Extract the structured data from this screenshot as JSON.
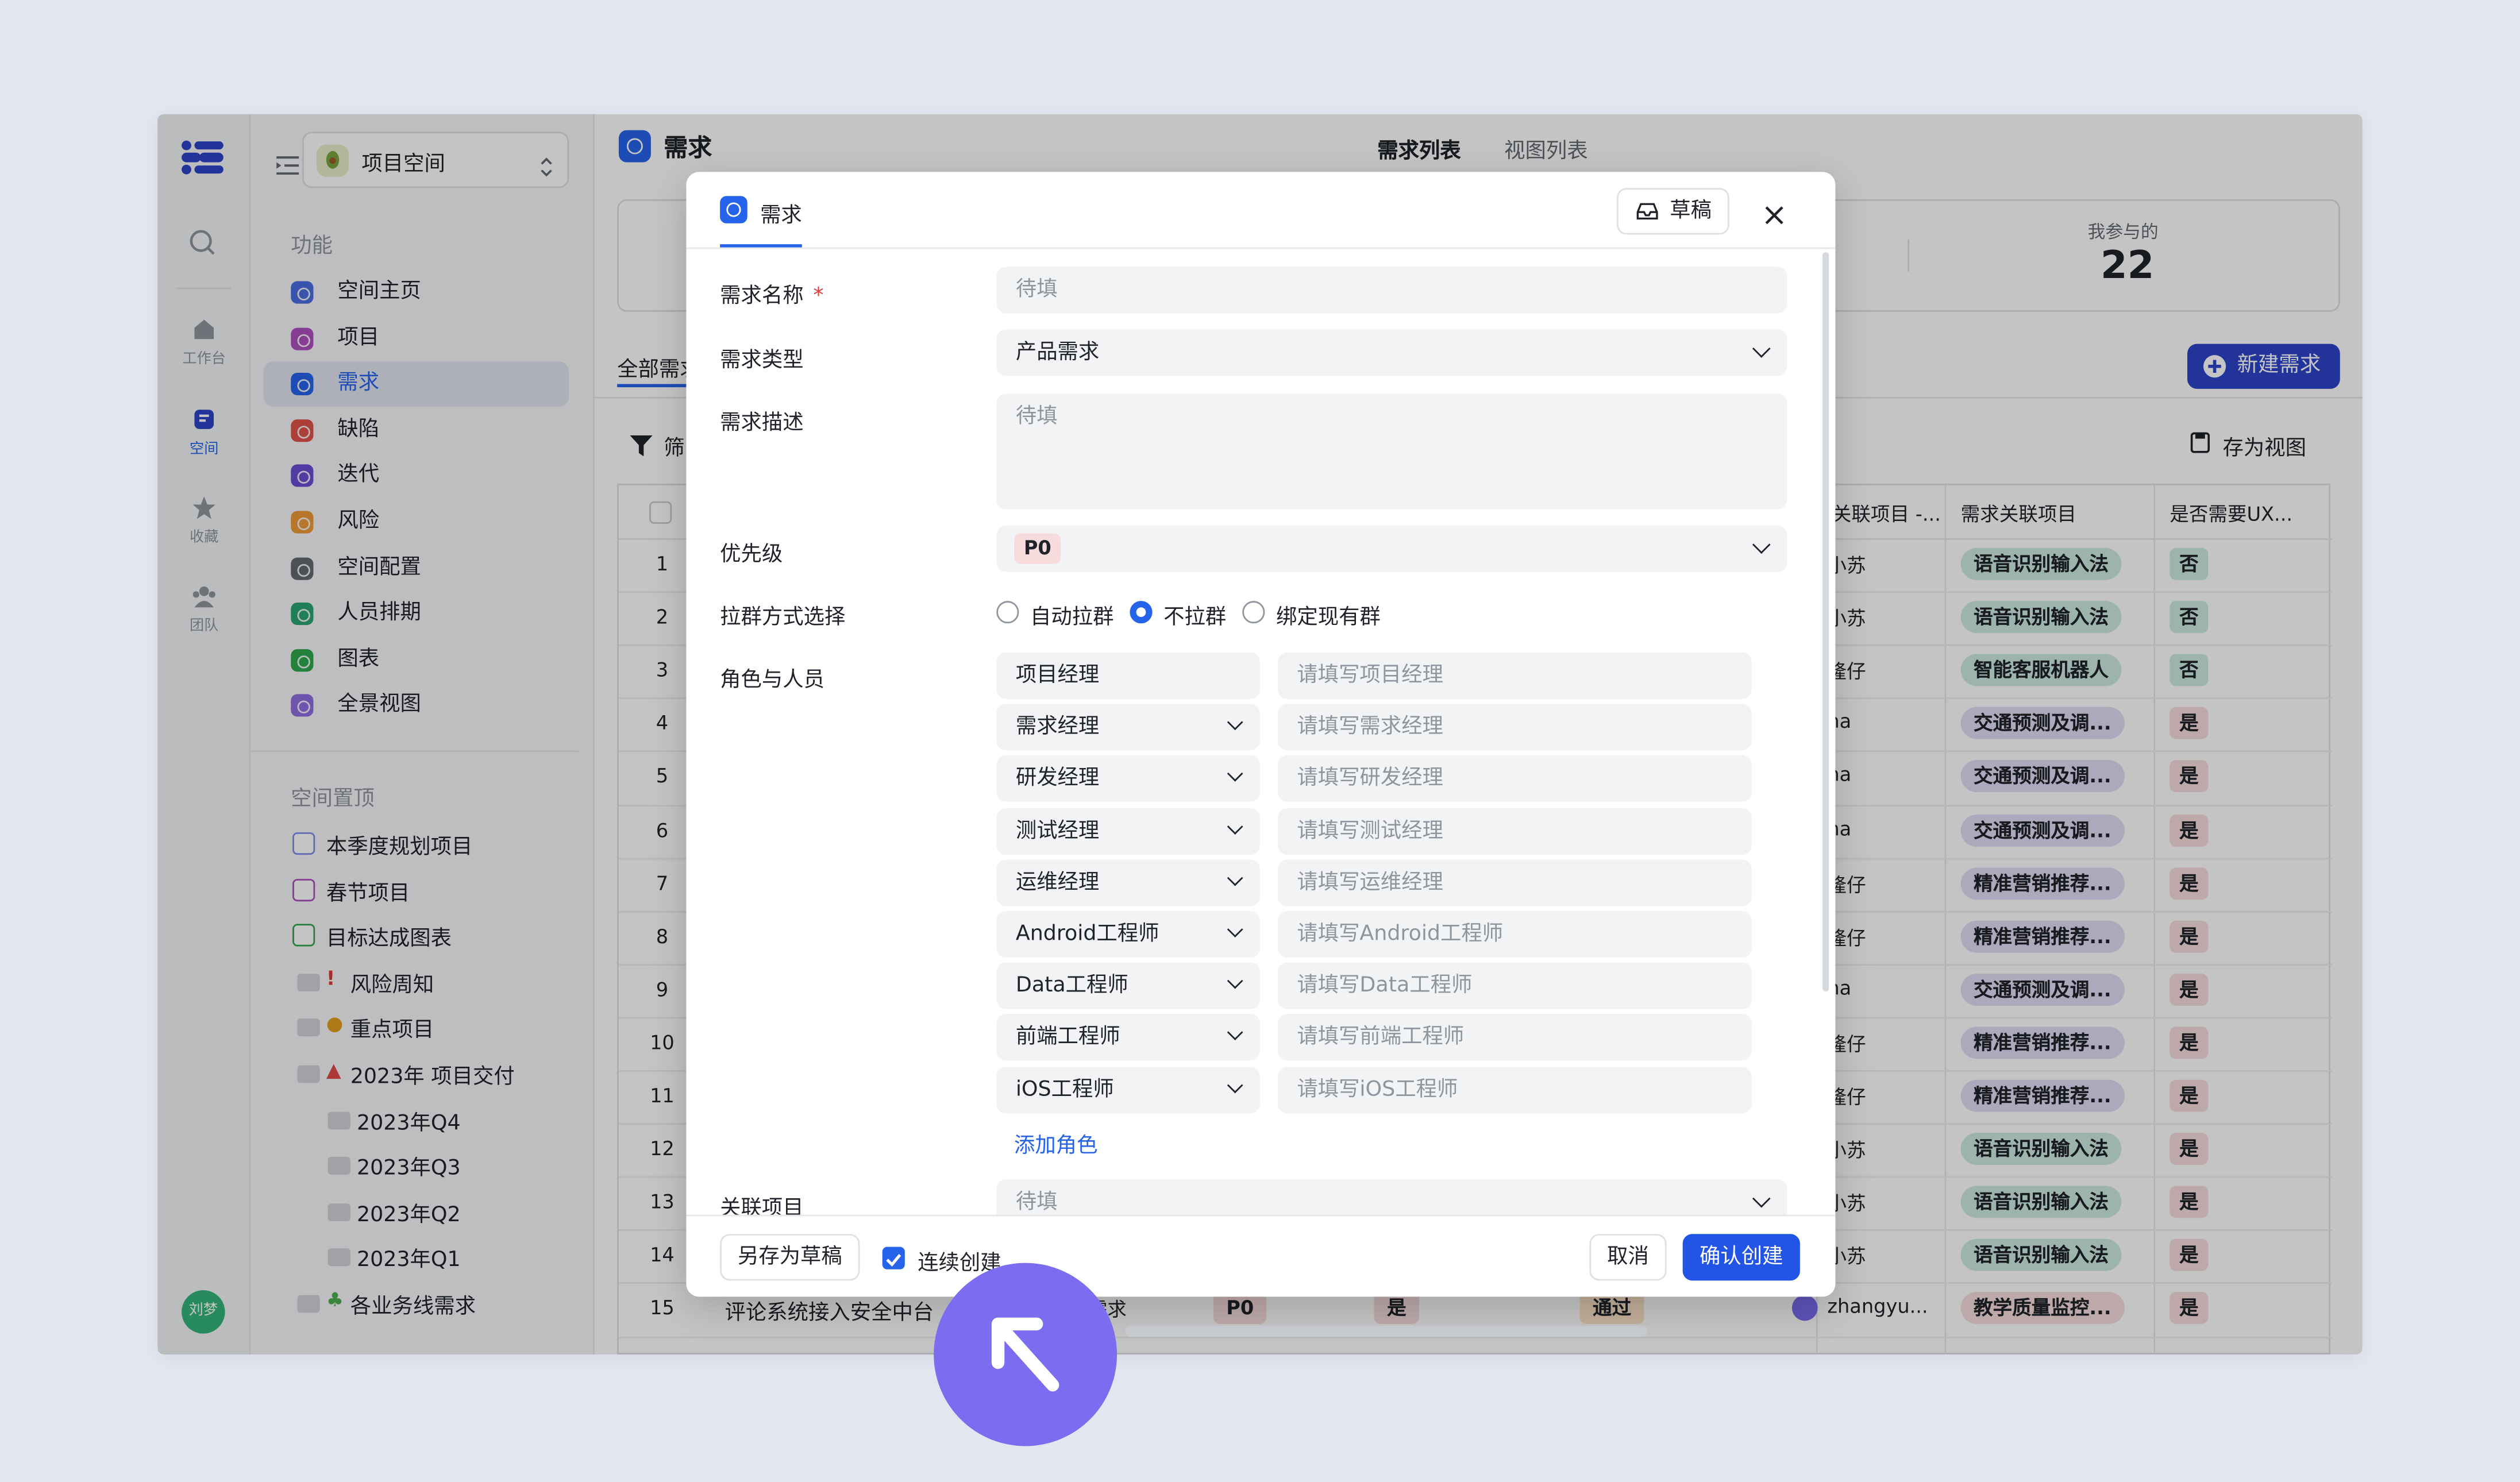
{
  "sidebar": {
    "space_name": "项目空间",
    "section_features": "功能",
    "items": [
      "空间主页",
      "项目",
      "需求",
      "缺陷",
      "迭代",
      "风险",
      "空间配置",
      "人员排期",
      "图表",
      "全景视图"
    ],
    "section_pinned": "空间置顶",
    "pinned": [
      "本季度规划项目",
      "春节项目",
      "目标达成图表",
      "风险周知",
      "重点项目",
      "2023年 项目交付",
      "2023年Q4",
      "2023年Q3",
      "2023年Q2",
      "2023年Q1",
      "各业务线需求"
    ],
    "user_avatar": "刘梦"
  },
  "rail": {
    "items": [
      "工作台",
      "空间",
      "收藏",
      "团队"
    ]
  },
  "main": {
    "page_title": "需求",
    "tabs": [
      "需求列表",
      "视图列表"
    ],
    "stat_label": "我参与的",
    "stat_value": "22",
    "tab_all": "全部需求",
    "new_button": "新建需求",
    "filter_label": "筛",
    "save_view": "存为视图",
    "columns": [
      "关联项目 -...",
      "需求关联项目",
      "是否需要UX..."
    ],
    "row_numbers": [
      "1",
      "2",
      "3",
      "4",
      "5",
      "6",
      "7",
      "8",
      "9",
      "10",
      "11",
      "12",
      "13",
      "14",
      "15"
    ],
    "rows": [
      {
        "owner": "小苏",
        "project": "语音识别输入法",
        "ux": "否"
      },
      {
        "owner": "小苏",
        "project": "语音识别输入法",
        "ux": "否"
      },
      {
        "owner": "隆仔",
        "project": "智能客服机器人",
        "ux": "否"
      },
      {
        "owner": "ha",
        "project": "交通预测及调...",
        "ux": "是"
      },
      {
        "owner": "ha",
        "project": "交通预测及调...",
        "ux": "是"
      },
      {
        "owner": "ha",
        "project": "交通预测及调...",
        "ux": "是"
      },
      {
        "owner": "隆仔",
        "project": "精准营销推荐...",
        "ux": "是"
      },
      {
        "owner": "隆仔",
        "project": "精准营销推荐...",
        "ux": "是"
      },
      {
        "owner": "ha",
        "project": "交通预测及调...",
        "ux": "是"
      },
      {
        "owner": "隆仔",
        "project": "精准营销推荐...",
        "ux": "是"
      },
      {
        "owner": "隆仔",
        "project": "精准营销推荐...",
        "ux": "是"
      },
      {
        "owner": "小苏",
        "project": "语音识别输入法",
        "ux": "是"
      },
      {
        "owner": "小苏",
        "project": "语音识别输入法",
        "ux": "是"
      },
      {
        "owner": "小苏",
        "project": "语音识别输入法",
        "ux": "是"
      }
    ],
    "last_row": {
      "title": "评论系统接入安全中台",
      "type": "需求",
      "priority": "P0",
      "flag": "是",
      "status": "通过",
      "owner": "zhangyu...",
      "project": "教学质量监控...",
      "ux": "是"
    }
  },
  "modal": {
    "tab": "需求",
    "draft_button": "草稿",
    "fields": {
      "name_label": "需求名称",
      "required_mark": "*",
      "name_placeholder": "待填",
      "type_label": "需求类型",
      "type_value": "产品需求",
      "desc_label": "需求描述",
      "desc_placeholder": "待填",
      "priority_label": "优先级",
      "priority_value": "P0",
      "group_label": "拉群方式选择",
      "group_options": [
        "自动拉群",
        "不拉群",
        "绑定现有群"
      ],
      "roles_label": "角色与人员",
      "roles": [
        {
          "role": "项目经理",
          "placeholder": "请填写项目经理"
        },
        {
          "role": "需求经理",
          "placeholder": "请填写需求经理"
        },
        {
          "role": "研发经理",
          "placeholder": "请填写研发经理"
        },
        {
          "role": "测试经理",
          "placeholder": "请填写测试经理"
        },
        {
          "role": "运维经理",
          "placeholder": "请填写运维经理"
        },
        {
          "role": "Android工程师",
          "placeholder": "请填写Android工程师"
        },
        {
          "role": "Data工程师",
          "placeholder": "请填写Data工程师"
        },
        {
          "role": "前端工程师",
          "placeholder": "请填写前端工程师"
        },
        {
          "role": "iOS工程师",
          "placeholder": "请填写iOS工程师"
        }
      ],
      "add_role": "添加角色",
      "project_label": "关联项目",
      "project_placeholder": "待填"
    },
    "footer": {
      "save_draft": "另存为草稿",
      "continuous": "连续创建",
      "cancel": "取消",
      "confirm": "确认创建"
    }
  },
  "colors": {
    "accent": "#2563eb",
    "cursor": "#7b6cf0",
    "tag_green": "#cdeae2",
    "tag_purple": "#e2dcf5",
    "tag_red": "#f6dcdc"
  }
}
